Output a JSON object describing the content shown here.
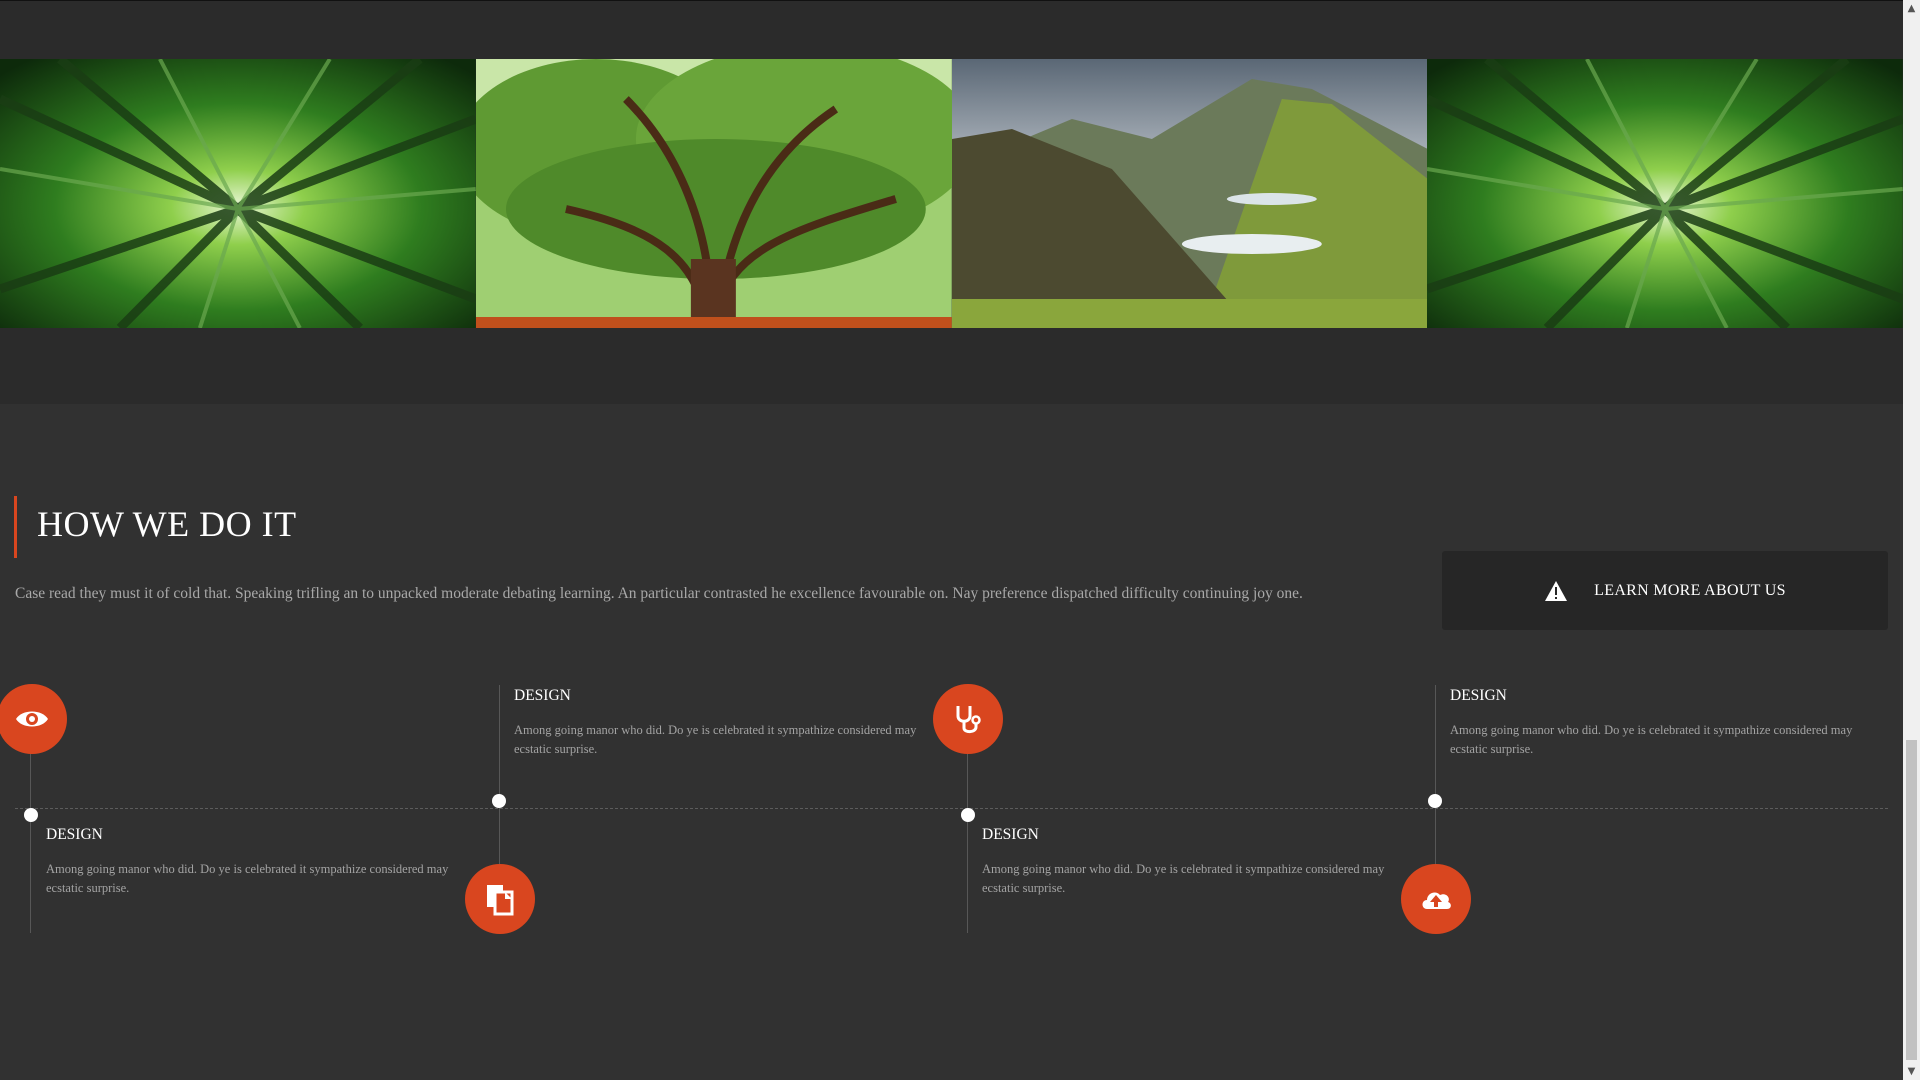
{
  "colors": {
    "accent": "#d9461f",
    "background": "#313131",
    "band": "#2b2b2b"
  },
  "gallery": {
    "photos": [
      {
        "name": "bamboo-forest"
      },
      {
        "name": "giant-oak-tree"
      },
      {
        "name": "mountain-valley"
      },
      {
        "name": "bamboo-forest"
      }
    ]
  },
  "how": {
    "title": "HOW WE DO IT",
    "intro": "Case read they must it of cold that. Speaking trifling an to unpacked moderate debating learning. An particular contrasted he excellence favourable on. Nay preference dispatched difficulty continuing joy one.",
    "learn_more": {
      "label": "LEARN MORE ABOUT US",
      "icon": "warning-icon"
    }
  },
  "steps": [
    {
      "icon": "eye-icon",
      "title": "DESIGN",
      "desc": "Among going manor who did. Do ye is celebrated it sympathize considered may ecstatic surprise."
    },
    {
      "icon": "documents-icon",
      "title": "DESIGN",
      "desc": "Among going manor who did. Do ye is celebrated it sympathize considered may ecstatic surprise."
    },
    {
      "icon": "stethoscope-icon",
      "title": "DESIGN",
      "desc": "Among going manor who did. Do ye is celebrated it sympathize considered may ecstatic surprise."
    },
    {
      "icon": "cloud-upload-icon",
      "title": "DESIGN",
      "desc": "Among going manor who did. Do ye is celebrated it sympathize considered may ecstatic surprise."
    }
  ]
}
